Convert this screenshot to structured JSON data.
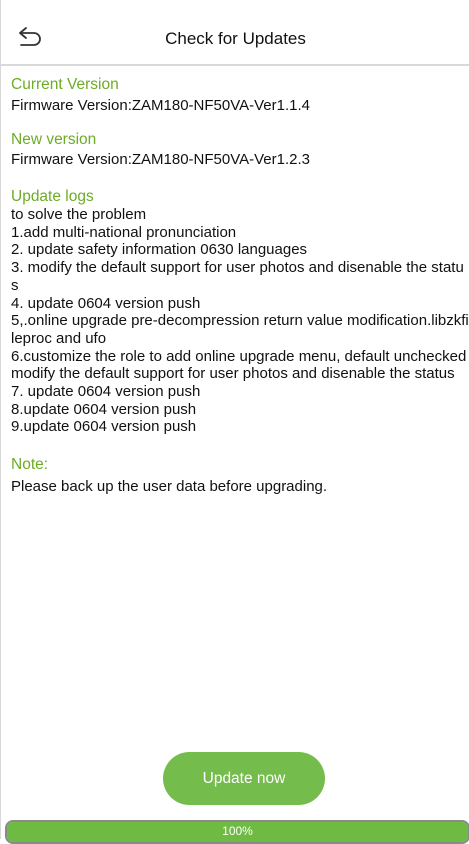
{
  "header": {
    "title": "Check for Updates"
  },
  "current_version": {
    "label": "Current Version",
    "value": "Firmware Version:ZAM180-NF50VA-Ver1.1.4"
  },
  "new_version": {
    "label": "New version",
    "value": "Firmware Version:ZAM180-NF50VA-Ver1.2.3"
  },
  "update_logs": {
    "label": "Update logs",
    "lines": [
      "to solve the problem",
      "1.add multi-national pronunciation",
      "2. update safety information 0630 languages",
      "3. modify the default support for user photos and disenable the status",
      "4. update 0604 version push",
      "5,.online upgrade pre-decompression return value modification.libzkfileproc and ufo",
      "6.customize the role to add online upgrade menu, default unchecked",
      "modify the default support for user photos and disenable the status",
      "7. update 0604 version push",
      "8.update 0604 version push",
      "9.update 0604 version push"
    ]
  },
  "note": {
    "label": "Note:",
    "text": "Please back up the user data before upgrading."
  },
  "actions": {
    "update_label": "Update now"
  },
  "progress": {
    "percent": 100,
    "label": "100%"
  },
  "colors": {
    "accent": "#6cac26",
    "button": "#74bc4b",
    "progress_fill": "#6fba43"
  },
  "icons": {
    "back": "back-arrow-icon"
  }
}
